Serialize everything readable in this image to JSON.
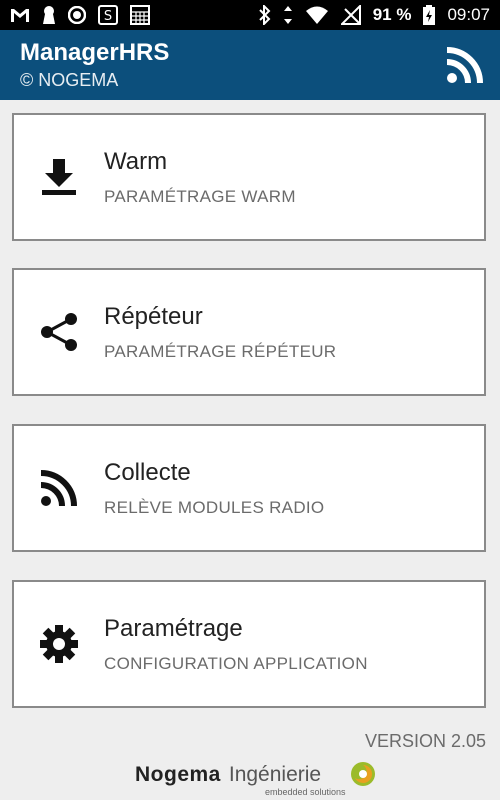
{
  "status_bar": {
    "battery_percent": "91 %",
    "time": "09:07",
    "left_icons": [
      "gmail-icon",
      "keyhole-icon",
      "record-icon",
      "s-square-icon",
      "calendar-grid-icon"
    ],
    "right_icons": [
      "bluetooth-icon",
      "data-arrows-icon",
      "wifi-icon",
      "no-signal-icon",
      "battery-charging-icon"
    ]
  },
  "app_bar": {
    "title": "ManagerHRS",
    "subtitle": "© NOGEMA",
    "background": "#0c4f7c",
    "action_icon": "rss-icon"
  },
  "menu": {
    "items": [
      {
        "title": "Warm",
        "subtitle": "PARAMÉTRAGE WARM",
        "icon": "download-icon"
      },
      {
        "title": "Répéteur",
        "subtitle": "PARAMÉTRAGE RÉPÉTEUR",
        "icon": "share-icon"
      },
      {
        "title": "Collecte",
        "subtitle": "RELÈVE MODULES RADIO",
        "icon": "rss-icon"
      },
      {
        "title": "Paramétrage",
        "subtitle": "CONFIGURATION APPLICATION",
        "icon": "gear-icon"
      }
    ]
  },
  "footer": {
    "version": "VERSION 2.05",
    "logo_brand": "Nogema",
    "logo_brand2": "Ingénierie",
    "logo_tagline": "embedded solutions"
  }
}
